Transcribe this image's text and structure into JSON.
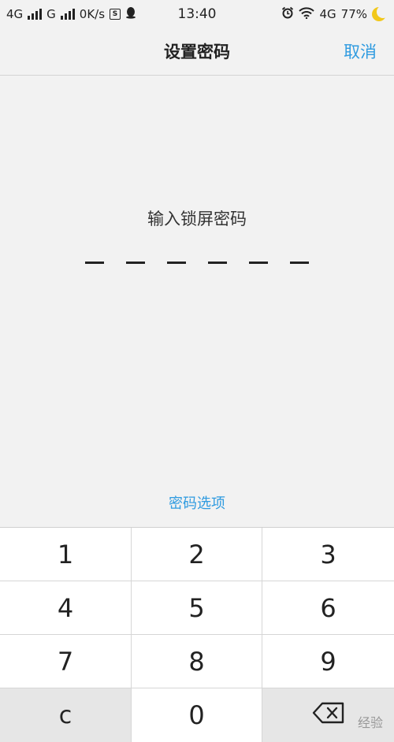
{
  "status_bar": {
    "net1": "4G",
    "net2": "G",
    "speed": "0K/s",
    "time": "13:40",
    "net3": "4G",
    "battery": "77%"
  },
  "navbar": {
    "title": "设置密码",
    "cancel_label": "取消"
  },
  "prompt": "输入锁屏密码",
  "password_slot_count": 6,
  "options_label": "密码选项",
  "keypad": {
    "k1": "1",
    "k2": "2",
    "k3": "3",
    "k4": "4",
    "k5": "5",
    "k6": "6",
    "k7": "7",
    "k8": "8",
    "k9": "9",
    "clear": "c",
    "k0": "0"
  },
  "watermark": "经验",
  "colors": {
    "accent": "#2f9be0",
    "background": "#f2f2f2"
  }
}
